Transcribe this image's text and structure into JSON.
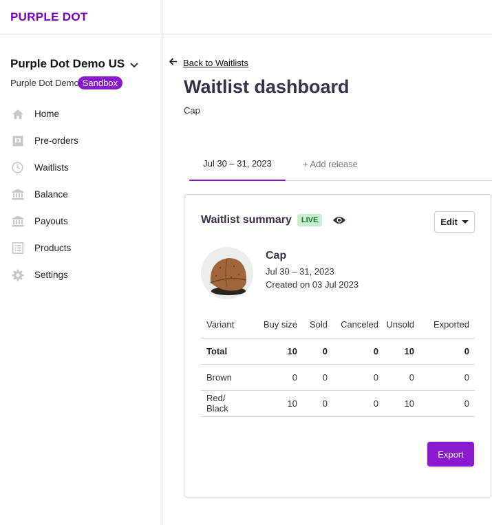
{
  "brand": {
    "logo": "PURPLE DOT",
    "color": "#7a00c8"
  },
  "store": {
    "name": "Purple Dot Demo US",
    "env_text": "Purple Dot Demo",
    "badge": "Sandbox"
  },
  "nav": [
    {
      "label": "Home",
      "icon": "home-icon"
    },
    {
      "label": "Pre-orders",
      "icon": "pre-orders-icon"
    },
    {
      "label": "Waitlists",
      "icon": "clock-icon"
    },
    {
      "label": "Balance",
      "icon": "bank-icon"
    },
    {
      "label": "Payouts",
      "icon": "bank-icon"
    },
    {
      "label": "Products",
      "icon": "list-icon"
    },
    {
      "label": "Settings",
      "icon": "gear-icon"
    }
  ],
  "page": {
    "back_label": "Back to Waitlists",
    "title": "Waitlist dashboard",
    "subtitle": "Cap",
    "tabs": {
      "active": "Jul 30 – 31, 2023",
      "add": "+ Add release"
    }
  },
  "summary": {
    "title": "Waitlist summary",
    "status": "LIVE",
    "edit_label": "Edit",
    "product": {
      "name": "Cap",
      "dates": "Jul 30 – 31, 2023",
      "created": "Created on 03 Jul 2023"
    },
    "table": {
      "headers": [
        "Variant",
        "Buy size",
        "Sold",
        "Canceled",
        "Unsold",
        "Exported"
      ],
      "rows": [
        [
          "Total",
          "10",
          "0",
          "0",
          "10",
          "0"
        ],
        [
          "Brown",
          "0",
          "0",
          "0",
          "0",
          "0"
        ],
        [
          "Red/ Black",
          "10",
          "0",
          "0",
          "10",
          "0"
        ]
      ]
    },
    "export_label": "Export"
  },
  "colors": {
    "accent": "#8a1ad0",
    "live_bg": "#c6f0cb",
    "live_text": "#1c6a2c"
  }
}
